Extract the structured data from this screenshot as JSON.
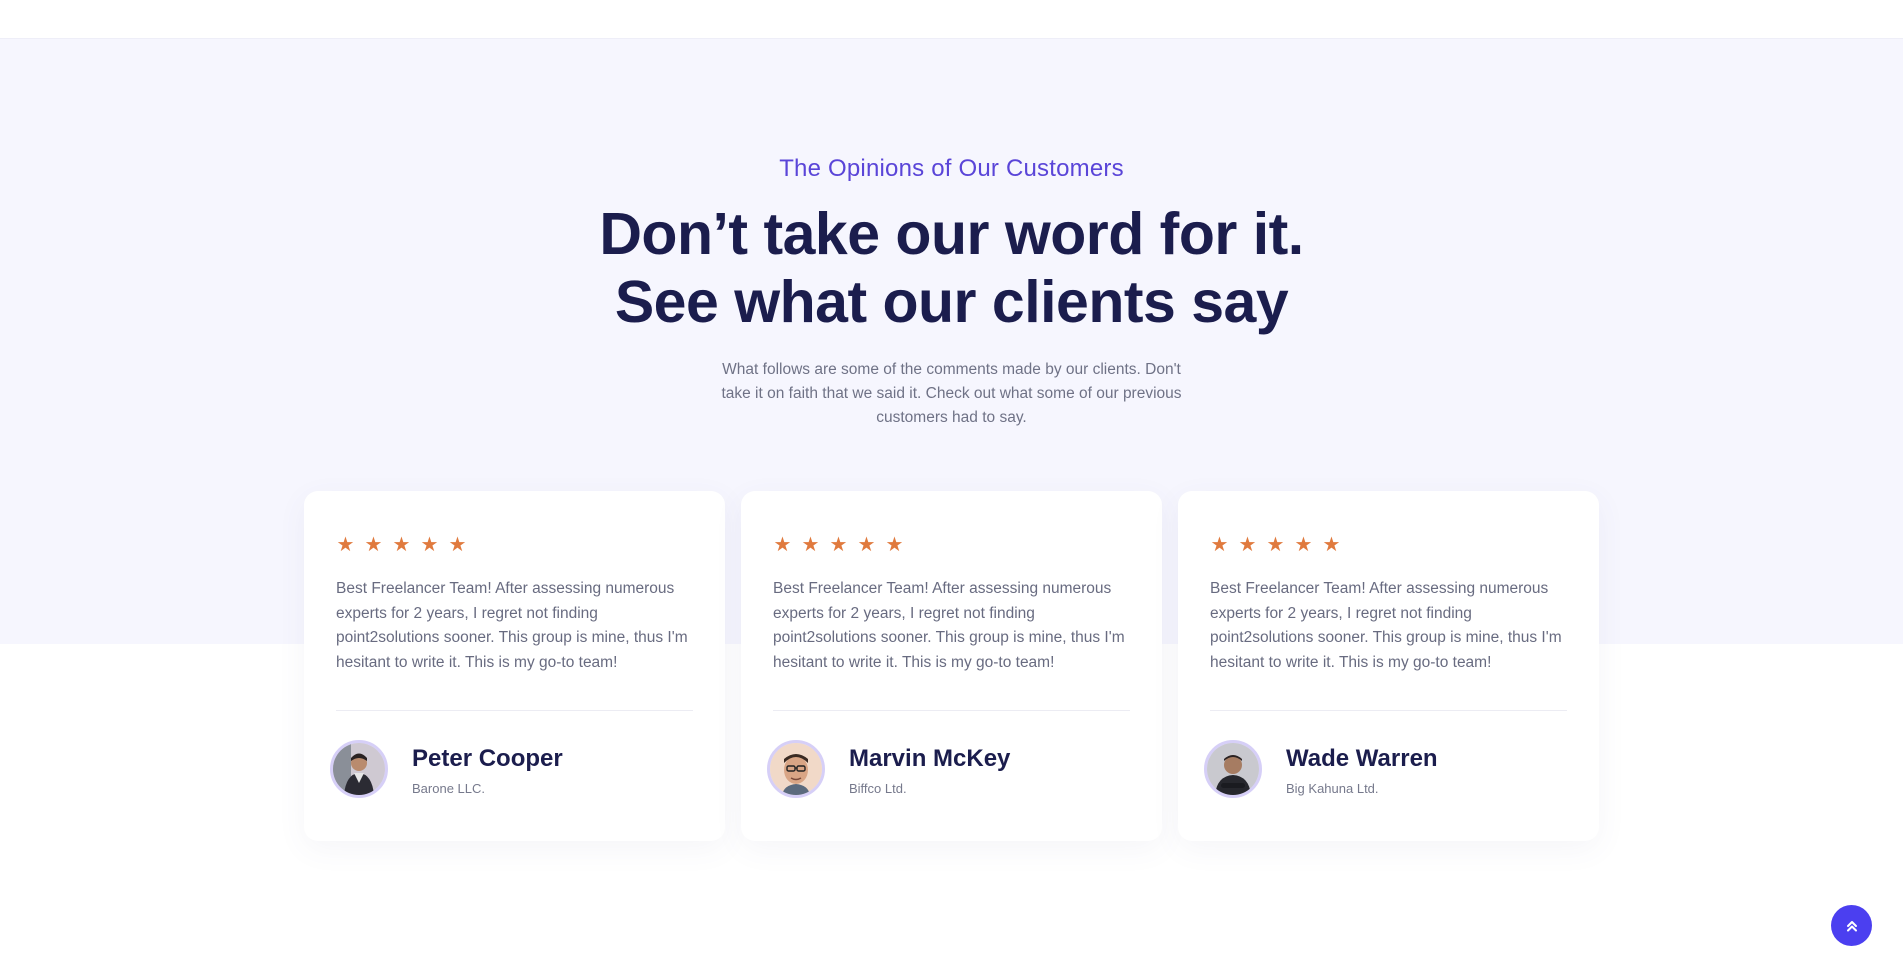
{
  "header": {
    "eyebrow": "The Opinions of Our Customers",
    "title_line1": "Don’t take our word for it.",
    "title_line2": "See what our clients say",
    "intro": "What follows are some of the comments made by our clients. Don't take it on faith that we said it. Check out what some of our previous customers had to say."
  },
  "testimonials": [
    {
      "rating": 5,
      "stars": [
        "★",
        "★",
        "★",
        "★",
        "★"
      ],
      "quote": "Best Freelancer Team! After assessing numerous experts for 2 years, I regret not finding point2solutions sooner. This group is mine, thus I'm hesitant to write it. This is my go-to team!",
      "name": "Peter Cooper",
      "company": "Barone LLC."
    },
    {
      "rating": 5,
      "stars": [
        "★",
        "★",
        "★",
        "★",
        "★"
      ],
      "quote": "Best Freelancer Team! After assessing numerous experts for 2 years, I regret not finding point2solutions sooner. This group is mine, thus I'm hesitant to write it. This is my go-to team!",
      "name": "Marvin McKey",
      "company": "Biffco Ltd."
    },
    {
      "rating": 5,
      "stars": [
        "★",
        "★",
        "★",
        "★",
        "★"
      ],
      "quote": "Best Freelancer Team! After assessing numerous experts for 2 years, I regret not finding point2solutions sooner. This group is mine, thus I'm hesitant to write it. This is my go-to team!",
      "name": "Wade Warren",
      "company": "Big Kahuna Ltd."
    }
  ],
  "colors": {
    "accent": "#5a45d8",
    "heading": "#1b1d4d",
    "star": "#e07a3e",
    "button": "#4b3ff0",
    "band": "#f6f6fe"
  },
  "icons": {
    "star": "star-icon",
    "scroll_top": "double-chevron-up-icon"
  }
}
